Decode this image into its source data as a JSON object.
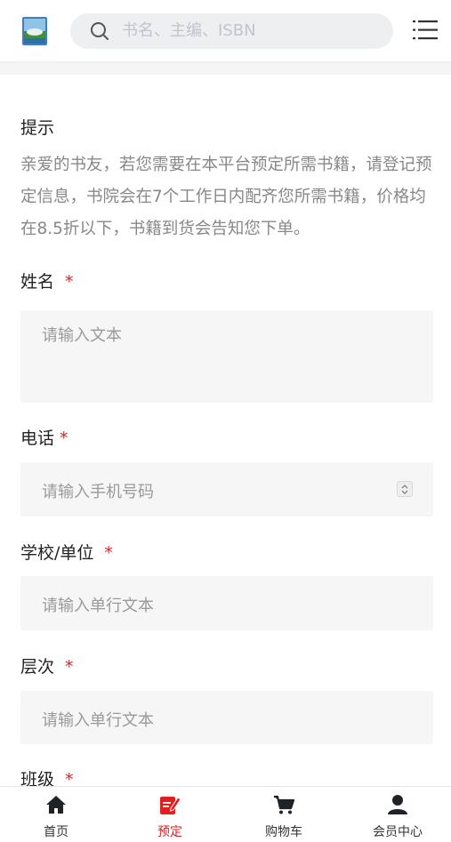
{
  "header": {
    "search_placeholder": "书名、主编、ISBN"
  },
  "notice": {
    "title": "提示",
    "text": "亲爱的书友，若您需要在本平台预定所需书籍，请登记预定信息，书院会在7个工作日内配齐您所需书籍，价格均在8.5折以下，书籍到货会告知您下单。"
  },
  "form": {
    "required_mark": "*",
    "fields": [
      {
        "label": "姓名",
        "placeholder": "请输入文本"
      },
      {
        "label": "电话",
        "placeholder": "请输入手机号码"
      },
      {
        "label": "学校/单位",
        "placeholder": "请输入单行文本"
      },
      {
        "label": "层次",
        "placeholder": "请输入单行文本"
      },
      {
        "label": "班级"
      }
    ]
  },
  "tabbar": {
    "items": [
      {
        "label": "首页",
        "icon": "home-icon"
      },
      {
        "label": "预定",
        "icon": "edit-icon"
      },
      {
        "label": "购物车",
        "icon": "cart-icon"
      },
      {
        "label": "会员中心",
        "icon": "user-icon"
      }
    ],
    "active_color": "#e02020"
  }
}
